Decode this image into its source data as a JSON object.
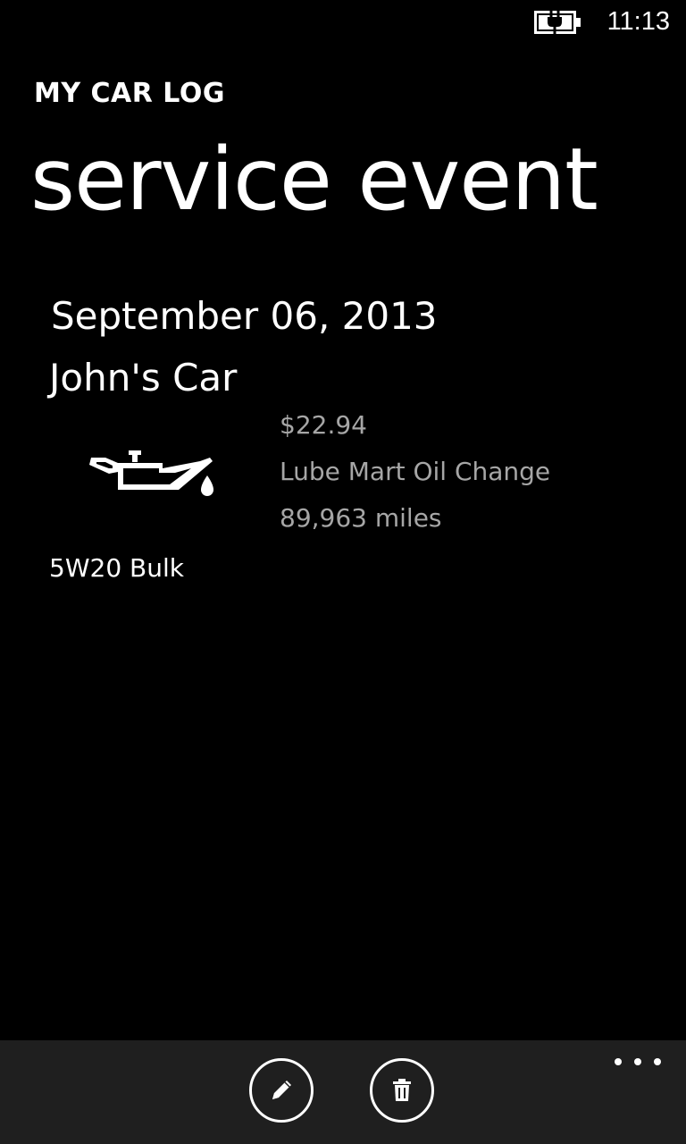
{
  "status_bar": {
    "time": "11:13",
    "battery_icon": "battery-charging-icon"
  },
  "header": {
    "app_title": "MY CAR LOG",
    "page_title": "service event"
  },
  "event": {
    "date": "September 06, 2013",
    "car": "John's Car",
    "service_icon": "oil-can-icon",
    "cost": "$22.94",
    "description": "Lube Mart Oil Change",
    "odometer": "89,963 miles",
    "notes": "5W20 Bulk"
  },
  "app_bar": {
    "buttons": [
      {
        "icon": "pencil-icon",
        "action": "edit"
      },
      {
        "icon": "trash-icon",
        "action": "delete"
      }
    ],
    "more_icon": "ellipsis-icon",
    "background": "#1f1f1f"
  },
  "colors": {
    "background": "#000000",
    "primary_text": "#ffffff",
    "secondary_text": "#a6a6a6"
  }
}
